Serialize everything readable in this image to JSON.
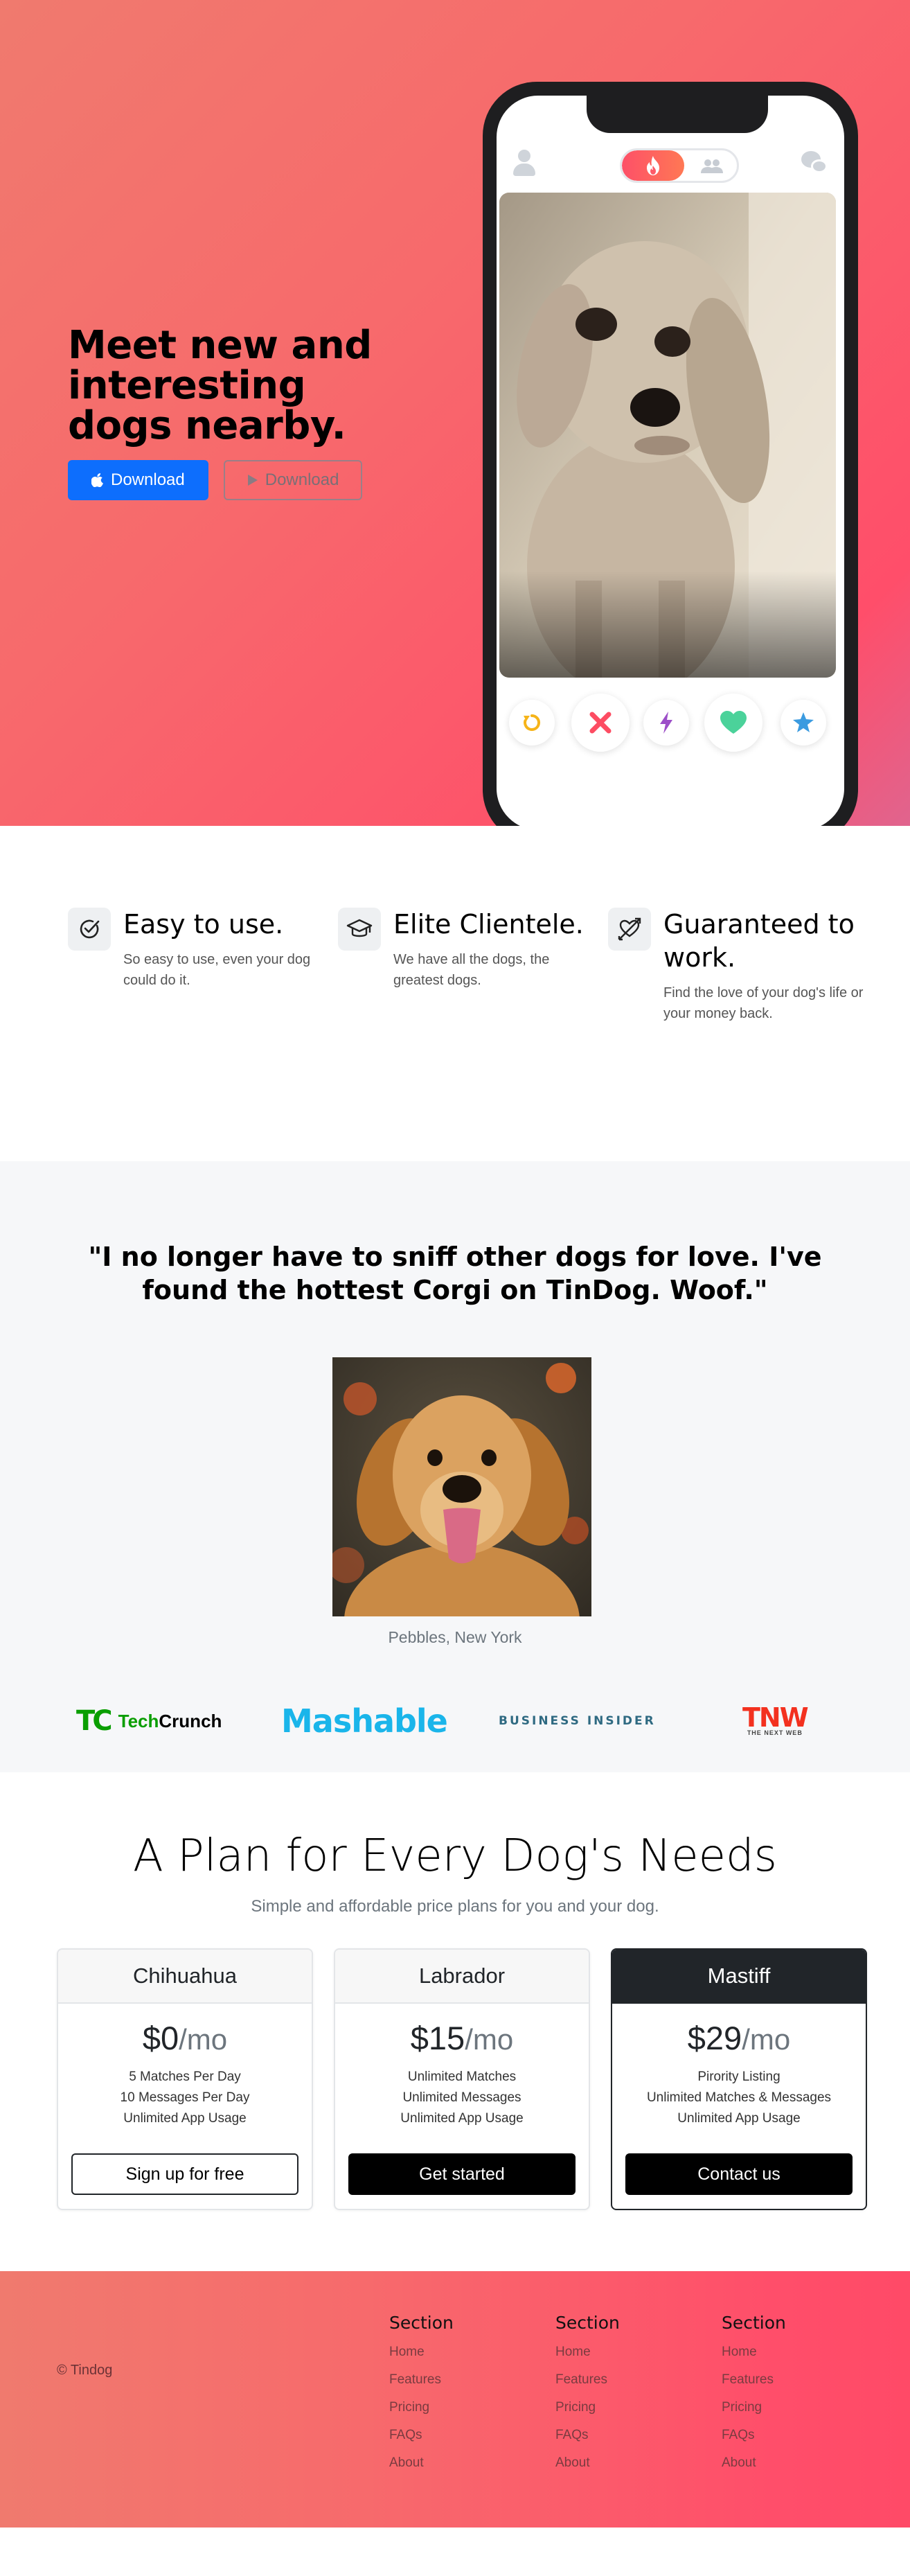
{
  "hero": {
    "title": "Meet new and interesting dogs nearby.",
    "download_primary": "Download",
    "download_outline": "Download"
  },
  "icons": {
    "apple": "apple-icon",
    "play": "play-icon",
    "profile": "profile-icon",
    "flame": "flame-icon",
    "group": "group-icon",
    "chat": "chat-icon",
    "rewind": "rewind-icon",
    "nope": "close-icon",
    "boost": "lightning-icon",
    "like": "heart-icon",
    "superlike": "star-icon"
  },
  "colors": {
    "brand_gradient_start": "#f07a6e",
    "brand_gradient_end": "#ff4e6a",
    "primary_button": "#0d6efd"
  },
  "features": [
    {
      "title": "Easy to use.",
      "text": "So easy to use, even your dog could do it.",
      "icon": "check-circle-icon"
    },
    {
      "title": "Elite Clientele.",
      "text": "We have all the dogs, the greatest dogs.",
      "icon": "graduation-cap-icon"
    },
    {
      "title": "Guaranteed to work.",
      "text": "Find the love of your dog's life or your money back.",
      "icon": "heart-arrow-icon"
    }
  ],
  "testimonial": {
    "quote": "\"I no longer have to sniff other dogs for love. I've found the hottest Corgi on TinDog. Woof.\"",
    "author": "Pebbles, New York"
  },
  "press": {
    "techcrunch_mark": "TC",
    "techcrunch_a": "Tech",
    "techcrunch_b": "Crunch",
    "mashable": "Mashable",
    "business_insider": "BUSINESS INSIDER",
    "tnw": "TNW",
    "tnw_sub": "THE NEXT WEB"
  },
  "pricing": {
    "title": "A Plan for Every Dog's Needs",
    "subtitle": "Simple and affordable price plans for you and your dog.",
    "plans": [
      {
        "name": "Chihuahua",
        "price": "$0",
        "period": "/mo",
        "features": [
          "5 Matches Per Day",
          "10 Messages Per Day",
          "Unlimited App Usage"
        ],
        "cta": "Sign up for free"
      },
      {
        "name": "Labrador",
        "price": "$15",
        "period": "/mo",
        "features": [
          "Unlimited Matches",
          "Unlimited Messages",
          "Unlimited App Usage"
        ],
        "cta": "Get started"
      },
      {
        "name": "Mastiff",
        "price": "$29",
        "period": "/mo",
        "features": [
          "Pirority Listing",
          "Unlimited Matches & Messages",
          "Unlimited App Usage"
        ],
        "cta": "Contact us"
      }
    ]
  },
  "footer": {
    "copyright": "© Tindog",
    "columns": [
      {
        "heading": "Section",
        "links": [
          "Home",
          "Features",
          "Pricing",
          "FAQs",
          "About"
        ]
      },
      {
        "heading": "Section",
        "links": [
          "Home",
          "Features",
          "Pricing",
          "FAQs",
          "About"
        ]
      },
      {
        "heading": "Section",
        "links": [
          "Home",
          "Features",
          "Pricing",
          "FAQs",
          "About"
        ]
      }
    ]
  }
}
